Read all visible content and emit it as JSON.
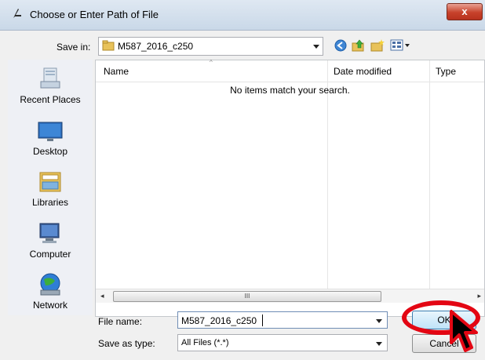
{
  "dialog": {
    "title": "Choose or Enter Path of File",
    "close_label": "x"
  },
  "save_in": {
    "label": "Save in:",
    "value": "M587_2016_c250"
  },
  "toolbar": {
    "icons": [
      "back-icon",
      "up-folder-icon",
      "new-folder-icon",
      "view-menu-icon"
    ]
  },
  "places": [
    {
      "label": "Recent Places",
      "icon": "recent-places-icon"
    },
    {
      "label": "Desktop",
      "icon": "desktop-icon"
    },
    {
      "label": "Libraries",
      "icon": "libraries-icon"
    },
    {
      "label": "Computer",
      "icon": "computer-icon"
    },
    {
      "label": "Network",
      "icon": "network-icon"
    }
  ],
  "file_list": {
    "columns": [
      "Name",
      "Date modified",
      "Type"
    ],
    "empty_message": "No items match your search.",
    "scroll_grip": "III"
  },
  "file_name": {
    "label": "File name:",
    "value": "M587_2016_c250"
  },
  "save_as_type": {
    "label": "Save as type:",
    "value": "All Files (*.*)"
  },
  "buttons": {
    "ok": "OK",
    "cancel": "Cancel"
  },
  "colors": {
    "highlight_ring": "#e30613",
    "ok_button": "#bfe3f8"
  }
}
